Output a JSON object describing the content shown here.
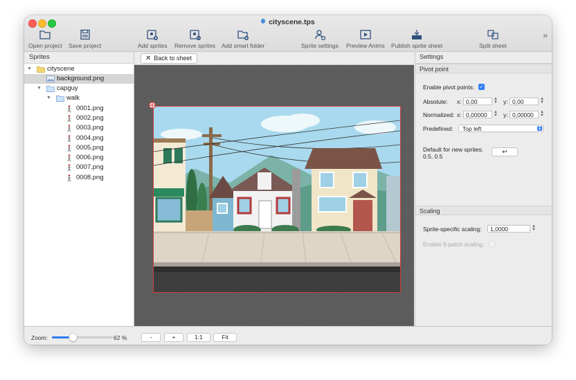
{
  "window": {
    "title": "cityscene.tps"
  },
  "toolbar": {
    "open_project": "Open project",
    "save_project": "Save project",
    "add_sprites": "Add sprites",
    "remove_sprites": "Remove sprites",
    "add_smart_folder": "Add smart folder",
    "sprite_settings": "Sprite settings",
    "preview_anims": "Preview Anims",
    "publish_sprite_sheet": "Publish sprite sheet",
    "split_sheet": "Split sheet",
    "more": "»"
  },
  "sprites_panel": {
    "title": "Sprites",
    "tree": [
      {
        "label": "cityscene",
        "type": "folder"
      },
      {
        "label": "background.png",
        "type": "image",
        "selected": true
      },
      {
        "label": "capguy",
        "type": "folder"
      },
      {
        "label": "walk",
        "type": "folder"
      },
      {
        "label": "0001.png",
        "type": "sprite"
      },
      {
        "label": "0002.png",
        "type": "sprite"
      },
      {
        "label": "0003.png",
        "type": "sprite"
      },
      {
        "label": "0004.png",
        "type": "sprite"
      },
      {
        "label": "0005.png",
        "type": "sprite"
      },
      {
        "label": "0006.png",
        "type": "sprite"
      },
      {
        "label": "0007.png",
        "type": "sprite"
      },
      {
        "label": "0008.png",
        "type": "sprite"
      }
    ]
  },
  "center": {
    "back_label": "Back to sheet"
  },
  "settings": {
    "title": "Settings",
    "pivot_section": "Pivot point",
    "enable_pivot_label": "Enable pivot points:",
    "enable_pivot_checked": true,
    "absolute_label": "Absolute:",
    "absolute_x_label": "x:",
    "absolute_x": "0,00",
    "absolute_y_label": "y:",
    "absolute_y": "0,00",
    "normalized_label": "Normalized:",
    "normalized_x_label": "x:",
    "normalized_x": "0,00000",
    "normalized_y_label": "y:",
    "normalized_y": "0,00000",
    "predefined_label": "Predefined:",
    "predefined_value": "Top left",
    "default_label": "Default for new sprites:",
    "default_value": "0.5, 0.5",
    "apply_default_symbol": "↩",
    "scaling_section": "Scaling",
    "sprite_scaling_label": "Sprite-specific scaling:",
    "sprite_scaling_value": "1,0000",
    "nine_patch_label": "Enable 9-patch scaling:",
    "nine_patch_checked": false
  },
  "status": {
    "zoom_label": "Zoom:",
    "zoom_value": "62 %",
    "zoom_fraction": 0.62,
    "zoom_out": "-",
    "zoom_in": "+",
    "zoom_actual": "1:1",
    "zoom_fit": "Fit"
  },
  "colors": {
    "accent": "#2f7cf6",
    "selection_border": "#d23b3b",
    "canvas_bg": "#5a5a5a"
  }
}
